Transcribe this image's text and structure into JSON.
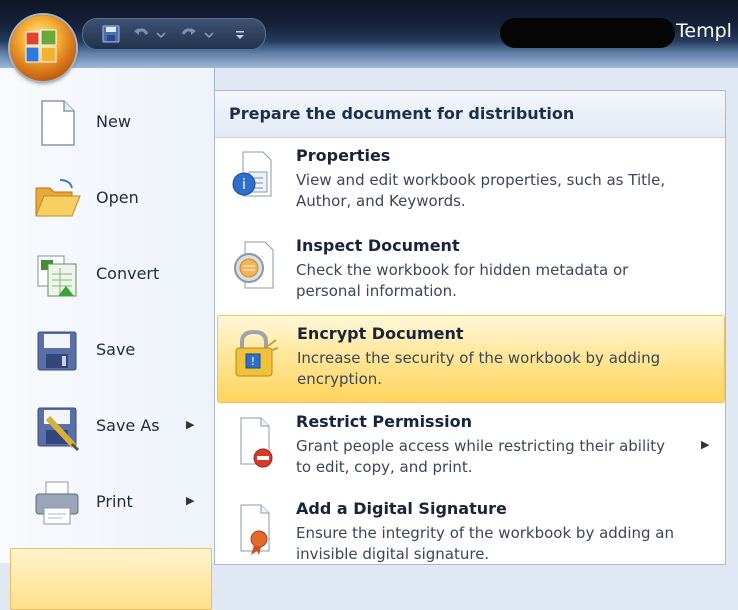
{
  "window": {
    "title_partial": "Templ"
  },
  "left_menu": [
    {
      "label": "New",
      "icon": "new-document-icon",
      "has_submenu": false
    },
    {
      "label": "Open",
      "icon": "open-folder-icon",
      "has_submenu": false
    },
    {
      "label": "Convert",
      "icon": "convert-icon",
      "has_submenu": false
    },
    {
      "label": "Save",
      "icon": "save-disk-icon",
      "has_submenu": false
    },
    {
      "label": "Save As",
      "icon": "save-as-icon",
      "has_submenu": true
    },
    {
      "label": "Print",
      "icon": "printer-icon",
      "has_submenu": true
    }
  ],
  "submenu": {
    "header": "Prepare the document for distribution",
    "items": [
      {
        "title": "Properties",
        "description": "View and edit workbook properties, such as Title, Author, and Keywords.",
        "icon": "properties-icon",
        "has_submenu": false
      },
      {
        "title": "Inspect Document",
        "description": "Check the workbook for hidden metadata or personal information.",
        "icon": "inspect-document-icon",
        "has_submenu": false
      },
      {
        "title": "Encrypt Document",
        "description": "Increase the security of the workbook by adding encryption.",
        "icon": "encrypt-lock-icon",
        "has_submenu": false,
        "highlighted": true
      },
      {
        "title": "Restrict Permission",
        "description": "Grant people access while restricting their ability to edit, copy, and print.",
        "icon": "restrict-permission-icon",
        "has_submenu": true
      },
      {
        "title": "Add a Digital Signature",
        "description": "Ensure the integrity of the workbook by adding an invisible digital signature.",
        "icon": "digital-signature-icon",
        "has_submenu": false
      }
    ]
  },
  "colors": {
    "highlight": "#ffd35c",
    "title_bar": "#16223a",
    "menu_border": "#a7b9d3"
  }
}
